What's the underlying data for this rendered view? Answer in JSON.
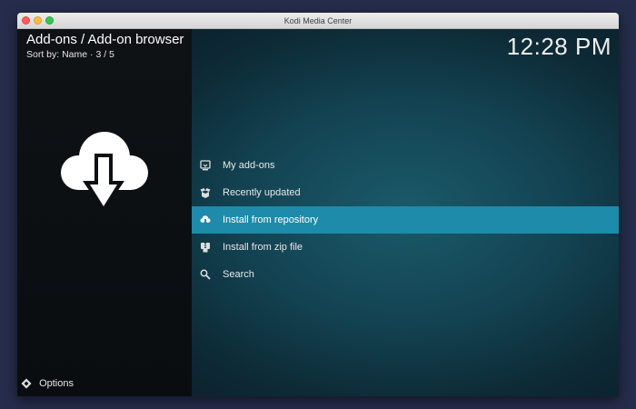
{
  "window": {
    "title": "Kodi Media Center"
  },
  "header": {
    "title": "Add-ons / Add-on browser",
    "sort_text": "Sort by: Name  ·  3 / 5",
    "clock": "12:28 PM"
  },
  "menu": {
    "items": [
      {
        "label": "My add-ons",
        "icon": "monitor-box-icon",
        "selected": false
      },
      {
        "label": "Recently updated",
        "icon": "open-box-icon",
        "selected": false
      },
      {
        "label": "Install from repository",
        "icon": "cloud-download-icon",
        "selected": true
      },
      {
        "label": "Install from zip file",
        "icon": "zip-file-icon",
        "selected": false
      },
      {
        "label": "Search",
        "icon": "search-icon",
        "selected": false
      }
    ]
  },
  "footer": {
    "options_label": "Options"
  },
  "colors": {
    "selection": "#1d8ba9",
    "background_teal": "#134352",
    "sidebar": "#0e1215",
    "desktop": "#262d4c"
  }
}
